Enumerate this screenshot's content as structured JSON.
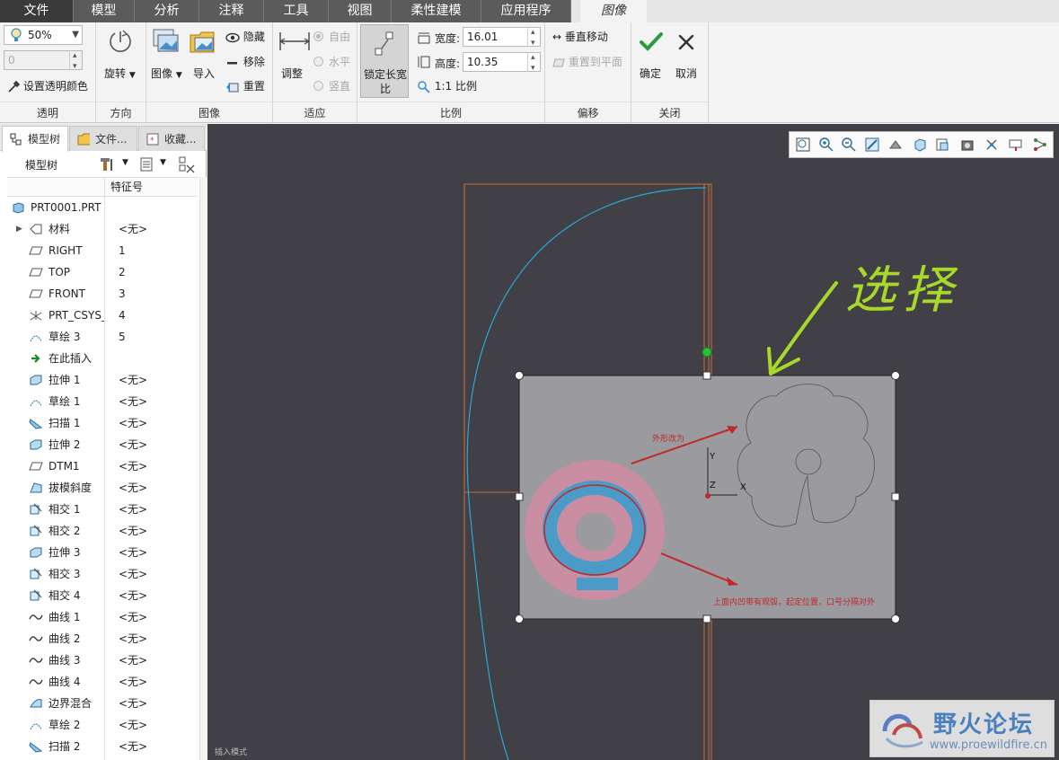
{
  "tabs": [
    "文件",
    "模型",
    "分析",
    "注释",
    "工具",
    "视图",
    "柔性建模",
    "应用程序",
    "图像"
  ],
  "ribbon": {
    "transparency": {
      "percent": "50%",
      "secondary_value": "0",
      "set_color_label": "设置透明颜色",
      "group_label": "透明"
    },
    "orientation": {
      "rotate_label": "旋转",
      "group_label": "方向"
    },
    "image": {
      "image_label": "图像",
      "import_label": "导入",
      "hide_label": "隐藏",
      "remove_label": "移除",
      "reset_label": "重置",
      "group_label": "图像"
    },
    "fit": {
      "adjust_label": "调整",
      "free_label": "自由",
      "horizontal_label": "水平",
      "vertical_label": "竖直",
      "group_label": "适应"
    },
    "scale": {
      "lock_ratio_line1": "锁定长宽",
      "lock_ratio_line2": "比",
      "width_label": "宽度:",
      "width_value": "16.01",
      "height_label": "高度:",
      "height_value": "10.35",
      "one_to_one_label": "1:1 比例",
      "group_label": "比例"
    },
    "offset": {
      "vertical_move_label": "垂直移动",
      "reset_to_plane_label": "重置到平面",
      "group_label": "偏移"
    },
    "close": {
      "ok_label": "确定",
      "cancel_label": "取消",
      "group_label": "关闭"
    }
  },
  "panel": {
    "tabs": [
      "模型树",
      "文件...",
      "收藏..."
    ],
    "toolbar_title": "模型树",
    "column_header": "特征号"
  },
  "tree": [
    {
      "name": "PRT0001.PRT",
      "id": ""
    },
    {
      "name": "材料",
      "id": "<无>"
    },
    {
      "name": "RIGHT",
      "id": "1"
    },
    {
      "name": "TOP",
      "id": "2"
    },
    {
      "name": "FRONT",
      "id": "3"
    },
    {
      "name": "PRT_CSYS_",
      "id": "4"
    },
    {
      "name": "草绘 3",
      "id": "5"
    },
    {
      "name": "在此插入",
      "id": ""
    },
    {
      "name": "拉伸 1",
      "id": "<无>"
    },
    {
      "name": "草绘 1",
      "id": "<无>"
    },
    {
      "name": "扫描 1",
      "id": "<无>"
    },
    {
      "name": "拉伸 2",
      "id": "<无>"
    },
    {
      "name": "DTM1",
      "id": "<无>"
    },
    {
      "name": "拔模斜度",
      "id": "<无>"
    },
    {
      "name": "相交 1",
      "id": "<无>"
    },
    {
      "name": "相交 2",
      "id": "<无>"
    },
    {
      "name": "拉伸 3",
      "id": "<无>"
    },
    {
      "name": "相交 3",
      "id": "<无>"
    },
    {
      "name": "相交 4",
      "id": "<无>"
    },
    {
      "name": "曲线 1",
      "id": "<无>"
    },
    {
      "name": "曲线 2",
      "id": "<无>"
    },
    {
      "name": "曲线 3",
      "id": "<无>"
    },
    {
      "name": "曲线 4",
      "id": "<无>"
    },
    {
      "name": "边界混合",
      "id": "<无>"
    },
    {
      "name": "草绘 2",
      "id": "<无>"
    },
    {
      "name": "扫描 2",
      "id": "<无>"
    }
  ],
  "canvas": {
    "annotation_handwritten": "选择",
    "image_note_top": "外形改为",
    "image_note_bottom": "上面内凹带有观弧，起定位置，口号分隔对外",
    "axis_y": "Y",
    "axis_z": "Z",
    "axis_x": "X",
    "status_text": "插入模式"
  },
  "watermark": {
    "title": "野火论坛",
    "url": "www.proewildfire.cn"
  },
  "colors": {
    "tab_bg": "#5b5b5b",
    "viewport_bg": "#414046",
    "sketch_curve": "#2aa7d8",
    "frame_orange": "#c8703a",
    "annotation_green": "#a8d82a",
    "image_note_red": "#c0282a",
    "ok_green": "#2a9a3a"
  }
}
